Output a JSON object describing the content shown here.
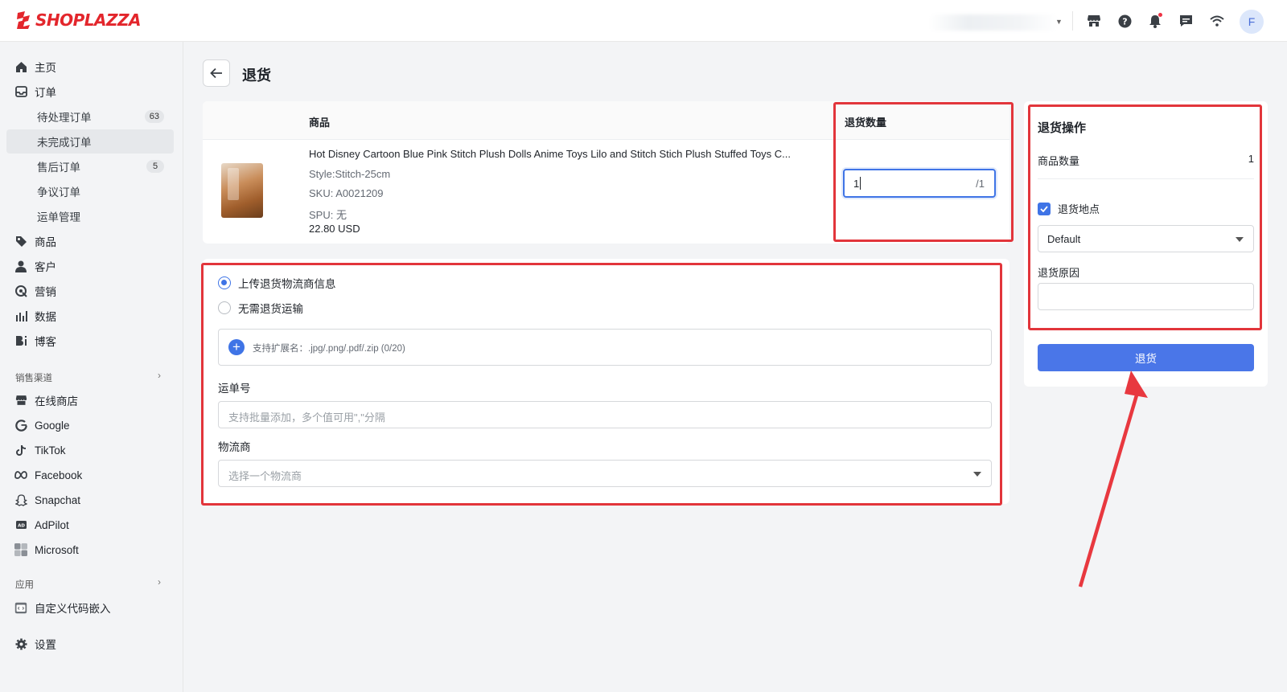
{
  "app": {
    "brand": "SHOPLAZZA",
    "avatar_initial": "F",
    "accent_color": "#3f74e6",
    "brand_color": "#e3262c"
  },
  "topbar": {
    "icons": [
      "store-icon",
      "help-icon",
      "bell-icon",
      "message-icon",
      "wifi-icon"
    ]
  },
  "sidebar": {
    "items": [
      {
        "label": "主页",
        "icon": "home-icon"
      },
      {
        "label": "订单",
        "icon": "inbox-icon"
      },
      {
        "label": "待处理订单",
        "badge": "63"
      },
      {
        "label": "未完成订单"
      },
      {
        "label": "售后订单",
        "badge": "5"
      },
      {
        "label": "争议订单"
      },
      {
        "label": "运单管理"
      },
      {
        "label": "商品",
        "icon": "tag-icon"
      },
      {
        "label": "客户",
        "icon": "person-icon"
      },
      {
        "label": "营销",
        "icon": "marketing-icon"
      },
      {
        "label": "数据",
        "icon": "bar-chart-icon"
      },
      {
        "label": "博客",
        "icon": "blog-icon"
      }
    ],
    "sales_channels_label": "销售渠道",
    "channels": [
      {
        "label": "在线商店",
        "icon": "store-icon"
      },
      {
        "label": "Google",
        "icon": "google-icon"
      },
      {
        "label": "TikTok",
        "icon": "tiktok-icon"
      },
      {
        "label": "Facebook",
        "icon": "meta-icon"
      },
      {
        "label": "Snapchat",
        "icon": "snapchat-icon"
      },
      {
        "label": "AdPilot",
        "icon": "adpilot-icon"
      },
      {
        "label": "Microsoft",
        "icon": "microsoft-icon"
      }
    ],
    "apps_label": "应用",
    "apps": [
      {
        "label": "自定义代码嵌入",
        "icon": "code-icon"
      }
    ],
    "settings_label": "设置"
  },
  "page": {
    "title": "退货"
  },
  "product_table": {
    "col_product": "商品",
    "col_qty": "退货数量",
    "product": {
      "title": "Hot Disney Cartoon Blue Pink Stitch Plush Dolls Anime Toys Lilo and Stitch Stich Plush Stuffed Toys C...",
      "style": "Style:Stitch-25cm",
      "sku": "SKU: A0021209",
      "spu": "SPU: 无",
      "price": "22.80 USD",
      "qty_value": "1",
      "qty_max": "/1"
    }
  },
  "shipping": {
    "option_upload": "上传退货物流商信息",
    "option_none": "无需退货运输",
    "upload_hint": "支持扩展名：.jpg/.png/.pdf/.zip (0/20)",
    "tracking_label": "运单号",
    "tracking_placeholder": "支持批量添加，多个值可用\",\"分隔",
    "carrier_label": "物流商",
    "carrier_placeholder": "选择一个物流商"
  },
  "return_panel": {
    "title": "退货操作",
    "qty_label": "商品数量",
    "qty_value": "1",
    "location_label": "退货地点",
    "location_value": "Default",
    "reason_label": "退货原因",
    "submit_label": "退货"
  }
}
